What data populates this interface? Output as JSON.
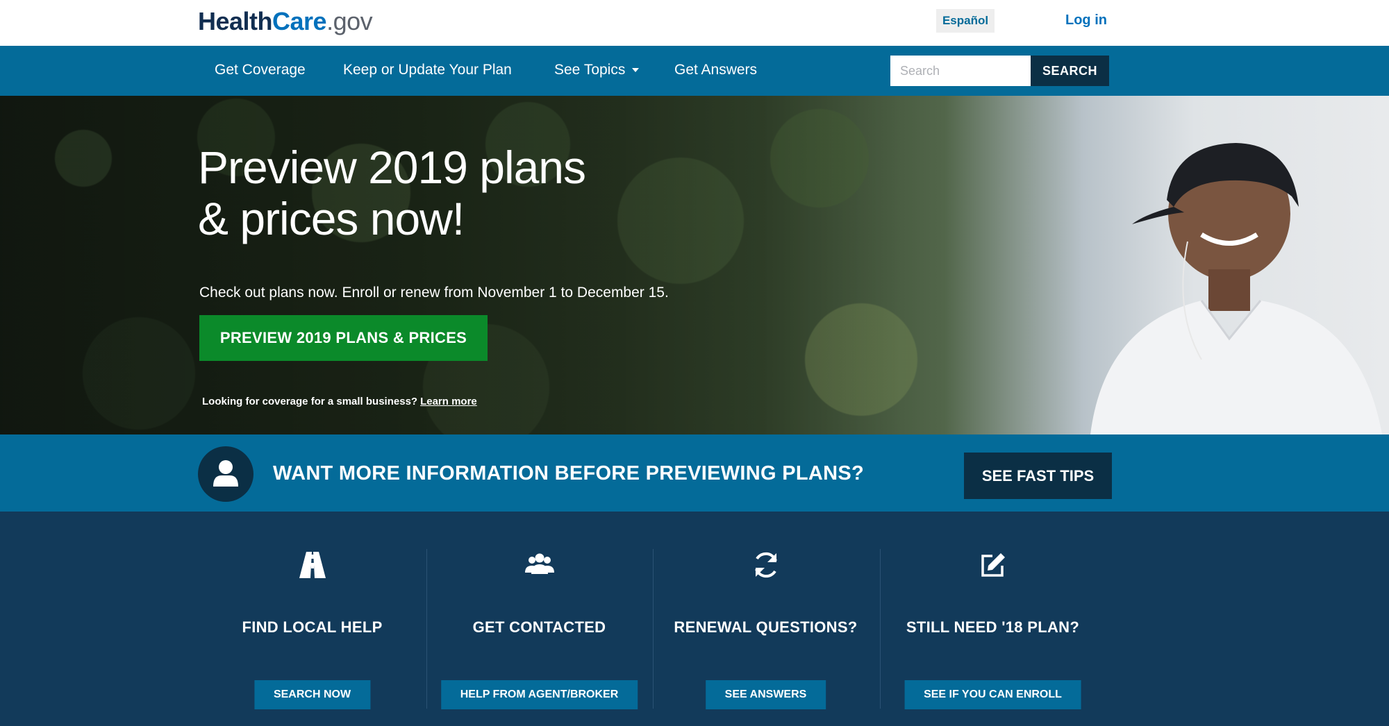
{
  "header": {
    "logo_part1": "Health",
    "logo_part2": "Care",
    "logo_part3": ".gov",
    "lang_label": "Español",
    "login_label": "Log in"
  },
  "nav": {
    "items": [
      {
        "label": "Get Coverage"
      },
      {
        "label": "Keep or Update Your Plan"
      },
      {
        "label": "See Topics"
      },
      {
        "label": "Get Answers"
      }
    ],
    "search_placeholder": "Search",
    "search_button": "SEARCH"
  },
  "hero": {
    "title_line1": "Preview 2019 plans",
    "title_line2": "& prices now!",
    "subtitle": "Check out plans now. Enroll or renew from November 1 to December 15.",
    "cta": "PREVIEW 2019 PLANS & PRICES",
    "small_text": "Looking for coverage for a small business?",
    "small_link": "Learn more"
  },
  "info": {
    "text": "WANT MORE INFORMATION BEFORE PREVIEWING PLANS?",
    "button": "SEE FAST TIPS"
  },
  "features": [
    {
      "icon": "road-icon",
      "title": "FIND LOCAL HELP",
      "button": "SEARCH NOW"
    },
    {
      "icon": "group-icon",
      "title": "GET CONTACTED",
      "button": "HELP FROM AGENT/BROKER"
    },
    {
      "icon": "refresh-icon",
      "title": "RENEWAL QUESTIONS?",
      "button": "SEE ANSWERS"
    },
    {
      "icon": "edit-icon",
      "title": "STILL NEED '18 PLAN?",
      "button": "SEE IF YOU CAN ENROLL"
    }
  ],
  "colors": {
    "nav_blue": "#046b99",
    "dark_navy": "#0b2f45",
    "features_bg": "#123a5a",
    "cta_green": "#0b8a2a"
  }
}
